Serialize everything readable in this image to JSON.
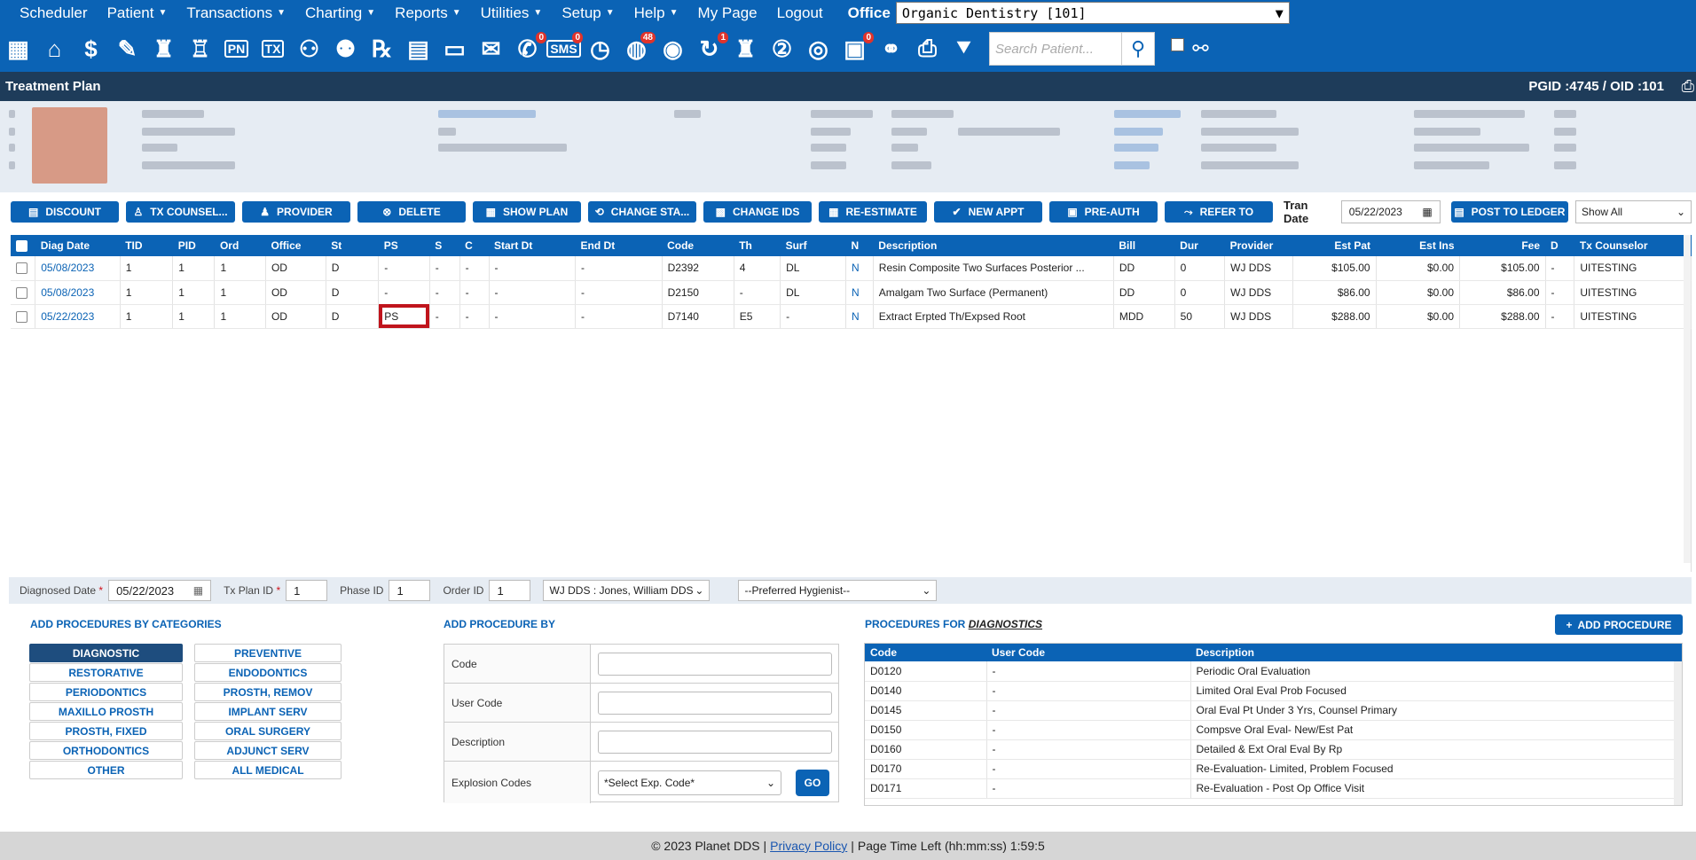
{
  "menu": {
    "items": [
      {
        "label": "Scheduler",
        "caret": false
      },
      {
        "label": "Patient",
        "caret": true
      },
      {
        "label": "Transactions",
        "caret": true
      },
      {
        "label": "Charting",
        "caret": true
      },
      {
        "label": "Reports",
        "caret": true
      },
      {
        "label": "Utilities",
        "caret": true
      },
      {
        "label": "Setup",
        "caret": true
      },
      {
        "label": "Help",
        "caret": true
      },
      {
        "label": "My Page",
        "caret": false
      },
      {
        "label": "Logout",
        "caret": false
      }
    ],
    "office_label": "Office",
    "office_value": "Organic Dentistry [101]"
  },
  "toolbar": {
    "icons": [
      {
        "name": "calendar-icon",
        "glyph": "▦",
        "badge": ""
      },
      {
        "name": "home-icon",
        "glyph": "⌂",
        "badge": ""
      },
      {
        "name": "dollar-icon",
        "glyph": "$",
        "badge": ""
      },
      {
        "name": "edit-icon",
        "glyph": "✎",
        "badge": ""
      },
      {
        "name": "tooth-icon",
        "glyph": "♜",
        "badge": ""
      },
      {
        "name": "tooth-chart-icon",
        "glyph": "♖",
        "badge": ""
      },
      {
        "name": "pn-icon",
        "text": "PN",
        "badge": ""
      },
      {
        "name": "tx-icon",
        "text": "TX",
        "badge": ""
      },
      {
        "name": "add-patient-icon",
        "glyph": "⚇",
        "badge": ""
      },
      {
        "name": "add-family-icon",
        "glyph": "⚉",
        "badge": ""
      },
      {
        "name": "rx-icon",
        "glyph": "℞",
        "badge": ""
      },
      {
        "name": "note-icon",
        "glyph": "▤",
        "badge": ""
      },
      {
        "name": "document-icon",
        "glyph": "▭",
        "badge": ""
      },
      {
        "name": "mail-icon",
        "glyph": "✉",
        "badge": ""
      },
      {
        "name": "message-icon",
        "glyph": "✆",
        "badge": "0"
      },
      {
        "name": "sms-icon",
        "text": "SMS",
        "badge": "0"
      },
      {
        "name": "clock-icon",
        "glyph": "◷",
        "badge": ""
      },
      {
        "name": "globe-people-icon",
        "glyph": "◍",
        "badge": "48"
      },
      {
        "name": "support-icon",
        "glyph": "◉",
        "badge": ""
      },
      {
        "name": "recall-icon",
        "glyph": "↻",
        "badge": "1"
      },
      {
        "name": "tooth-outline-icon",
        "glyph": "♜",
        "badge": ""
      },
      {
        "name": "tooth-number-icon",
        "glyph": "②",
        "badge": ""
      },
      {
        "name": "web-icon",
        "glyph": "◎",
        "badge": ""
      },
      {
        "name": "form-icon",
        "glyph": "▣",
        "badge": "0"
      },
      {
        "name": "family-icon",
        "glyph": "⚭",
        "badge": ""
      },
      {
        "name": "print-icon",
        "glyph": "⎙",
        "badge": ""
      },
      {
        "name": "expand-icon",
        "glyph": "⯆",
        "badge": ""
      }
    ],
    "search_placeholder": "Search Patient..."
  },
  "title": {
    "text": "Treatment Plan",
    "ids": "PGID :4745  /  OID :101"
  },
  "actions": {
    "buttons": [
      {
        "label": "DISCOUNT",
        "icon": "▤",
        "w": 122
      },
      {
        "label": "TX COUNSEL...",
        "icon": "♙",
        "w": 123
      },
      {
        "label": "PROVIDER",
        "icon": "♟",
        "w": 122
      },
      {
        "label": "DELETE",
        "icon": "⊗",
        "w": 122
      },
      {
        "label": "SHOW PLAN",
        "icon": "▦",
        "w": 122
      },
      {
        "label": "CHANGE STA...",
        "icon": "⟲",
        "w": 122
      },
      {
        "label": "CHANGE IDS",
        "icon": "▩",
        "w": 122
      },
      {
        "label": "RE-ESTIMATE",
        "icon": "▦",
        "w": 122
      },
      {
        "label": "NEW APPT",
        "icon": "✔",
        "w": 122
      },
      {
        "label": "PRE-AUTH",
        "icon": "▣",
        "w": 122
      },
      {
        "label": "REFER TO",
        "icon": "⤳",
        "w": 122
      }
    ],
    "tran_date_label": "Tran Date",
    "tran_date_value": "05/22/2023",
    "post_ledger": "POST TO LEDGER",
    "show_all": "Show All"
  },
  "table": {
    "columns": [
      "Diag Date",
      "TID",
      "PID",
      "Ord",
      "Office",
      "St",
      "PS",
      "S",
      "C",
      "Start Dt",
      "End Dt",
      "Code",
      "Th",
      "Surf",
      "N",
      "Description",
      "Bill",
      "Dur",
      "Provider",
      "Est Pat",
      "Est Ins",
      "Fee",
      "D",
      "Tx Counselor"
    ],
    "rows": [
      [
        "05/08/2023",
        "1",
        "1",
        "1",
        "OD",
        "D",
        "-",
        "-",
        "-",
        "-",
        "-",
        "D2392",
        "4",
        "DL",
        "N",
        "Resin Composite Two Surfaces Posterior ...",
        "DD",
        "0",
        "WJ DDS",
        "$105.00",
        "$0.00",
        "$105.00",
        "-",
        "UITESTING"
      ],
      [
        "05/08/2023",
        "1",
        "1",
        "1",
        "OD",
        "D",
        "-",
        "-",
        "-",
        "-",
        "-",
        "D2150",
        "-",
        "DL",
        "N",
        "Amalgam Two Surface (Permanent)",
        "DD",
        "0",
        "WJ DDS",
        "$86.00",
        "$0.00",
        "$86.00",
        "-",
        "UITESTING"
      ],
      [
        "05/22/2023",
        "1",
        "1",
        "1",
        "OD",
        "D",
        "PS",
        "-",
        "-",
        "-",
        "-",
        "D7140",
        "E5",
        "-",
        "N",
        "Extract Erpted Th/Expsed Root",
        "MDD",
        "50",
        "WJ DDS",
        "$288.00",
        "$0.00",
        "$288.00",
        "-",
        "UITESTING"
      ]
    ]
  },
  "diag": {
    "diagnosed_label": "Diagnosed Date",
    "diagnosed_value": "05/22/2023",
    "txplan_label": "Tx Plan ID",
    "txplan_value": "1",
    "phase_label": "Phase ID",
    "phase_value": "1",
    "order_label": "Order ID",
    "order_value": "1",
    "provider_value": "WJ DDS : Jones, William DDS",
    "hygienist_value": "--Preferred Hygienist--"
  },
  "categories": {
    "title": "ADD PROCEDURES BY CATEGORIES",
    "items": [
      "DIAGNOSTIC",
      "PREVENTIVE",
      "RESTORATIVE",
      "ENDODONTICS",
      "PERIODONTICS",
      "PROSTH, REMOV",
      "MAXILLO PROSTH",
      "IMPLANT SERV",
      "PROSTH, FIXED",
      "ORAL SURGERY",
      "ORTHODONTICS",
      "ADJUNCT SERV",
      "OTHER",
      "ALL MEDICAL"
    ]
  },
  "addby": {
    "title": "ADD PROCEDURE BY",
    "code_label": "Code",
    "user_code_label": "User Code",
    "description_label": "Description",
    "explosion_label": "Explosion Codes",
    "explosion_value": "*Select Exp. Code*",
    "go_label": "GO"
  },
  "procedures": {
    "title_prefix": "PROCEDURES FOR ",
    "title_category": "DIAGNOSTICS",
    "add_label": "ADD PROCEDURE",
    "columns": [
      "Code",
      "User Code",
      "Description"
    ],
    "rows": [
      [
        "D0120",
        "-",
        "Periodic Oral Evaluation"
      ],
      [
        "D0140",
        "-",
        "Limited Oral Eval Prob Focused"
      ],
      [
        "D0145",
        "-",
        "Oral Eval Pt Under 3 Yrs, Counsel Primary"
      ],
      [
        "D0150",
        "-",
        "Compsve Oral Eval- New/Est Pat"
      ],
      [
        "D0160",
        "-",
        "Detailed & Ext Oral Eval By Rp"
      ],
      [
        "D0170",
        "-",
        "Re-Evaluation- Limited, Problem Focused"
      ],
      [
        "D0171",
        "-",
        "Re-Evaluation - Post Op Office Visit"
      ]
    ]
  },
  "footer": {
    "copyright": "© 2023 Planet DDS |",
    "privacy": "Privacy Policy",
    "sep": "|",
    "time_left": "Page Time Left (hh:mm:ss) 1:59:5"
  },
  "colors": {
    "primary": "#0b63b5",
    "dark": "#1e3c5a",
    "highlight": "#c0141c"
  }
}
